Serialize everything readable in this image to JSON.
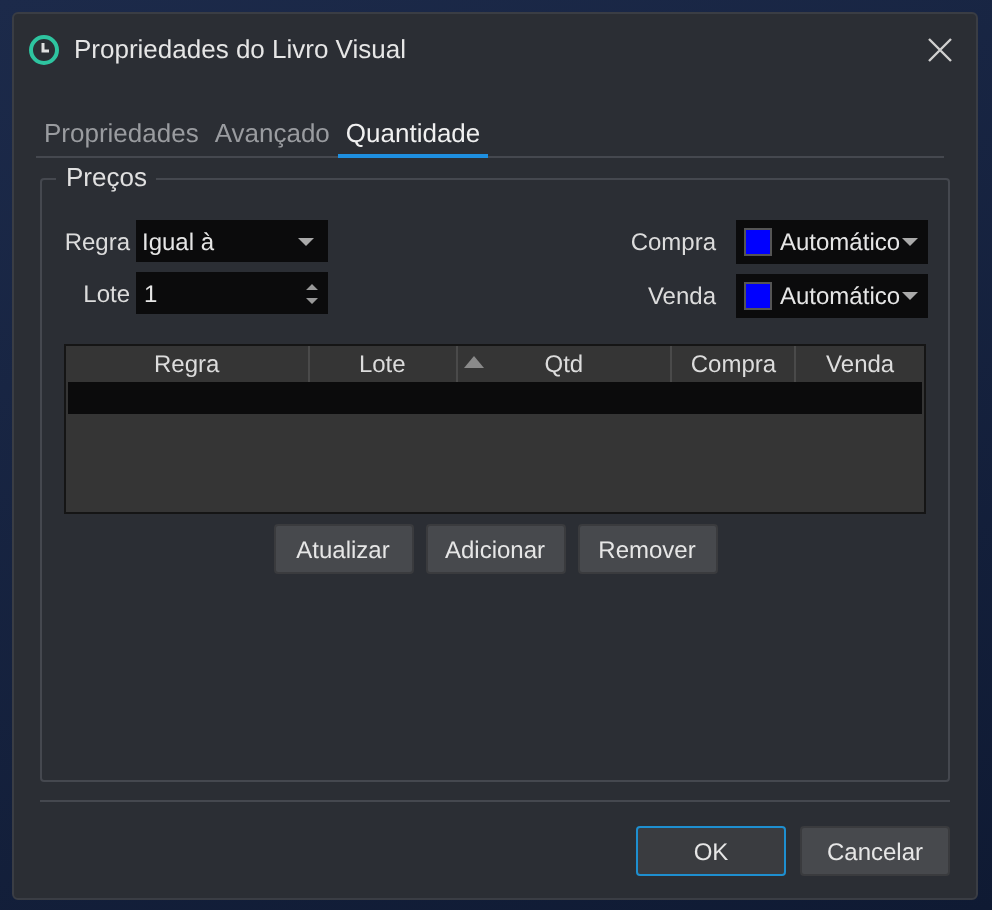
{
  "window": {
    "title": "Propriedades do Livro Visual"
  },
  "tabs": [
    {
      "label": "Propriedades",
      "selected": false
    },
    {
      "label": "Avançado",
      "selected": false
    },
    {
      "label": "Quantidade",
      "selected": true
    }
  ],
  "group": {
    "title": "Preços",
    "regra": {
      "label": "Regra",
      "value": "Igual à"
    },
    "lote": {
      "label": "Lote",
      "value": "1"
    },
    "compra": {
      "label": "Compra",
      "color": "#0000ff",
      "value": "Automático"
    },
    "venda": {
      "label": "Venda",
      "color": "#0000ff",
      "value": "Automático"
    },
    "table": {
      "columns": [
        {
          "label": "Regra",
          "sorted": false
        },
        {
          "label": "Lote",
          "sorted": false
        },
        {
          "label": "Qtd",
          "sorted": true
        },
        {
          "label": "Compra",
          "sorted": false
        },
        {
          "label": "Venda",
          "sorted": false
        }
      ],
      "rows": [
        {
          "selected": true
        }
      ]
    },
    "buttons": [
      "Atualizar",
      "Adicionar",
      "Remover"
    ]
  },
  "footer_buttons": [
    {
      "label": "OK",
      "default": true
    },
    {
      "label": "Cancelar",
      "default": false
    }
  ]
}
